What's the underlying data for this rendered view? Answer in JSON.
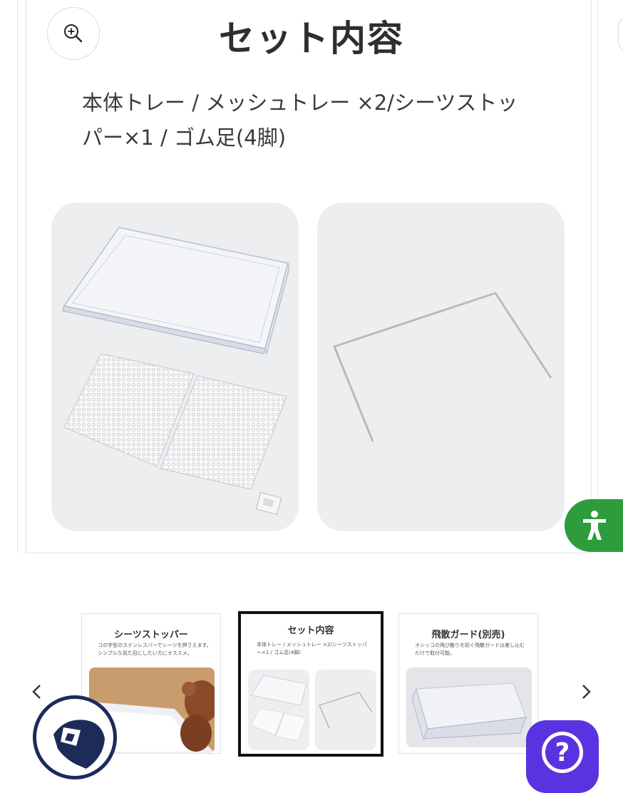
{
  "slide": {
    "title": "セット内容",
    "description": "本体トレー / メッシュトレー ×2/シーツストッパー×1 / ゴム足(4脚)",
    "images": [
      "product-trays-image",
      "sheet-stopper-image"
    ]
  },
  "thumbnails": [
    {
      "title": "シーツストッパー",
      "text": "コの字型のステンレスバーでシーツを押さえます。シンプルな見た目にしたい方にオススメ。"
    },
    {
      "title": "セット内容",
      "text": "本体トレー / メッシュトレー ×2/シーツストッパー×1 / ゴム足(4脚)",
      "selected": true
    },
    {
      "title": "飛散ガード(別売)",
      "text": "オシッコの飛び散りを防ぐ飛散ガードは差し込むだけで取付可能。"
    }
  ],
  "help": {
    "symbol": "?"
  },
  "colors": {
    "accessibility_green": "#2e9c3c",
    "help_purple": "#5a33e0",
    "logo_navy": "#1c2b5a"
  },
  "icons": [
    "zoom-in-icon",
    "accessibility-icon",
    "chevron-left-icon",
    "chevron-right-icon",
    "question-icon"
  ]
}
